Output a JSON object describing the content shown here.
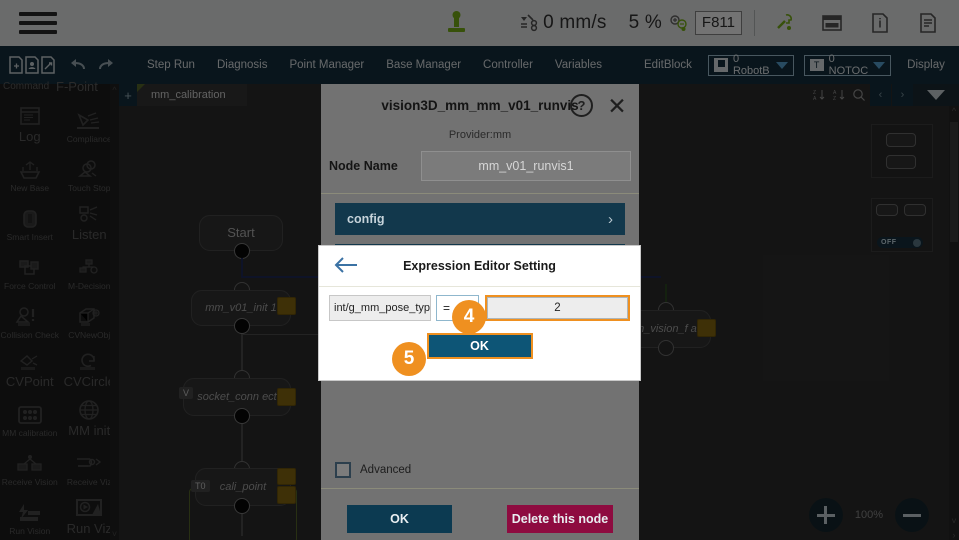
{
  "statusbar": {
    "menu_icon": "hamburger-icon",
    "robot_icon": "robot-jog-icon",
    "speed_icon": "speed-icon",
    "speed": "0 mm/s",
    "override": "5 %",
    "override_icon": "override-icon",
    "frame": "F811",
    "tool_icon": "tool-icon",
    "keyboard_icon": "keyboard-icon",
    "info_icon": "info-icon",
    "log_icon": "log-icon"
  },
  "toolbar": {
    "icons": [
      "new-project-icon",
      "open-project-icon",
      "save-project-icon"
    ],
    "undo_icon": "undo-icon",
    "redo_icon": "redo-icon",
    "items": [
      "Step Run",
      "Diagnosis",
      "Point Manager",
      "Base Manager",
      "Controller",
      "Variables"
    ],
    "editblock_label": "EditBlock",
    "robot_select": {
      "chip": "R",
      "label": "0 RobotB",
      "icon": "chevron-down-icon"
    },
    "tool_select": {
      "chip": "T",
      "label": "0 NOTOC",
      "icon": "chevron-down-icon"
    },
    "display_label": "Display",
    "panel_icon": "panel-layout-icon"
  },
  "left_panel": {
    "header_left": "Command",
    "header_right": "F-Point",
    "scroll_up_icon": "chevron-up-icon",
    "scroll_down_icon": "chevron-down-icon",
    "items": [
      {
        "label": "Log",
        "icon": "log-window-icon",
        "big": true
      },
      {
        "label": "Compliance",
        "icon": "compliance-icon",
        "big": false
      },
      {
        "label": "New Base",
        "icon": "new-base-icon",
        "big": false
      },
      {
        "label": "Touch Stop",
        "icon": "touch-stop-icon",
        "big": false
      },
      {
        "label": "Smart Insert",
        "icon": "smart-insert-icon",
        "big": false
      },
      {
        "label": "Listen",
        "icon": "listen-icon",
        "big": true
      },
      {
        "label": "Force Control",
        "icon": "force-control-icon",
        "big": false
      },
      {
        "label": "M-Decision",
        "icon": "m-decision-icon",
        "big": false
      },
      {
        "label": "Collision Check",
        "icon": "collision-check-icon",
        "big": false
      },
      {
        "label": "CVNewObj",
        "icon": "cv-new-obj-icon",
        "big": false
      },
      {
        "label": "CVPoint",
        "icon": "cv-point-icon",
        "big": true
      },
      {
        "label": "CVCircle",
        "icon": "cv-circle-icon",
        "big": true
      },
      {
        "label": "MM calibration",
        "icon": "mm-calibration-icon",
        "big": false
      },
      {
        "label": "MM init",
        "icon": "mm-init-icon",
        "big": true
      },
      {
        "label": "Receive Vision",
        "icon": "receive-vision-icon",
        "big": false
      },
      {
        "label": "Receive Viz",
        "icon": "receive-viz-icon",
        "big": false
      },
      {
        "label": "Run Vision",
        "icon": "run-vision-icon",
        "big": false
      },
      {
        "label": "Run Viz",
        "icon": "run-viz-icon",
        "big": true
      }
    ]
  },
  "canvas": {
    "add_tab_icon": "plus-icon",
    "tab_label": "mm_calibration",
    "sort_az_icon": "sort-az-icon",
    "sort_za_icon": "sort-za-icon",
    "zoom_fit_icon": "zoom-fit-icon",
    "prev_icon": "chevron-left-icon",
    "next_icon": "chevron-right-icon",
    "dropdown_icon": "chevron-down-icon",
    "nodes": [
      {
        "label": "Start"
      },
      {
        "label": "mm_v01_init 1"
      },
      {
        "label": "socket_conn ect",
        "chip": "V"
      },
      {
        "label": "cali_point",
        "chip": "T0"
      },
      {
        "label": "run_vision_f ail"
      }
    ],
    "zoom_in_icon": "zoom-in-icon",
    "zoom_out_icon": "zoom-out-icon",
    "zoom_level": "100%",
    "off_toggle": "OFF"
  },
  "node_dialog": {
    "title": "vision3D_mm_mm_v01_runvis",
    "help_icon": "help-icon",
    "close_icon": "close-icon",
    "provider": "Provider:mm",
    "node_name_label": "Node Name",
    "node_name_value": "mm_v01_runvis1",
    "sections": [
      {
        "label": "config",
        "chev": "›"
      }
    ],
    "advanced_label": "Advanced",
    "ok_label": "OK",
    "delete_label": "Delete this node"
  },
  "expression_editor": {
    "back_icon": "back-arrow-icon",
    "title": "Expression Editor Setting",
    "variable": "int/g_mm_pose_typ",
    "operator": "=",
    "value": "2",
    "ok_label": "OK"
  },
  "step_markers": [
    {
      "id": "4",
      "label": "4"
    },
    {
      "id": "5",
      "label": "5"
    }
  ],
  "colors": {
    "accent_orange": "#ef9020",
    "toolbar_dark": "#14303f",
    "section_blue": "#12384c",
    "delete_red": "#8e0b40",
    "status_green": "#7ab317"
  }
}
